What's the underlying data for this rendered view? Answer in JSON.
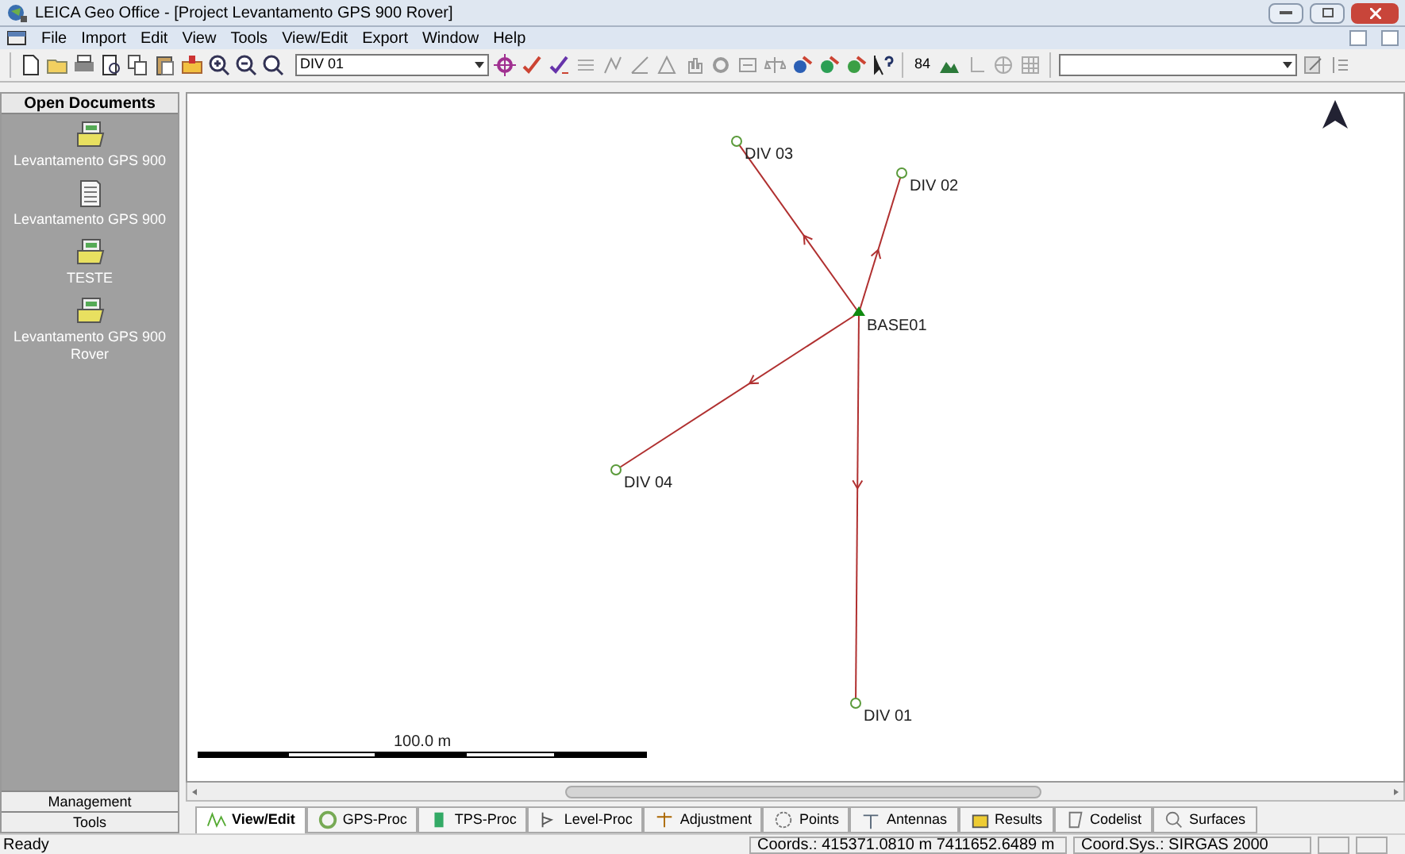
{
  "window": {
    "title": "LEICA Geo Office - [Project Levantamento GPS 900 Rover]"
  },
  "menu": [
    "File",
    "Import",
    "Edit",
    "View",
    "Tools",
    "View/Edit",
    "Export",
    "Window",
    "Help"
  ],
  "toolbar": {
    "point_select": "DIV 01",
    "counter": "84"
  },
  "sidebar": {
    "title": "Open Documents",
    "items": [
      {
        "label": "Levantamento GPS 900",
        "kind": "folder"
      },
      {
        "label": "Levantamento GPS 900",
        "kind": "sheet"
      },
      {
        "label": "TESTE",
        "kind": "folder"
      },
      {
        "label": "Levantamento GPS 900 Rover",
        "kind": "folder"
      }
    ],
    "bottom_buttons": [
      "Management",
      "Tools"
    ]
  },
  "map": {
    "points": [
      {
        "name": "BASE01",
        "kind": "base"
      },
      {
        "name": "DIV 03",
        "kind": "rover"
      },
      {
        "name": "DIV 02",
        "kind": "rover"
      },
      {
        "name": "DIV 04",
        "kind": "rover"
      },
      {
        "name": "DIV 01",
        "kind": "rover"
      }
    ],
    "scale_label": "100.0 m"
  },
  "tabs": [
    {
      "label": "View/Edit",
      "selected": true
    },
    {
      "label": "GPS-Proc",
      "selected": false
    },
    {
      "label": "TPS-Proc",
      "selected": false
    },
    {
      "label": "Level-Proc",
      "selected": false
    },
    {
      "label": "Adjustment",
      "selected": false
    },
    {
      "label": "Points",
      "selected": false
    },
    {
      "label": "Antennas",
      "selected": false
    },
    {
      "label": "Results",
      "selected": false
    },
    {
      "label": "Codelist",
      "selected": false
    },
    {
      "label": "Surfaces",
      "selected": false
    }
  ],
  "status_bar": {
    "message": "Ready",
    "coords": "Coords.: 415371.0810 m  7411652.6489 m",
    "coord_sys": "Coord.Sys.: SIRGAS 2000"
  }
}
